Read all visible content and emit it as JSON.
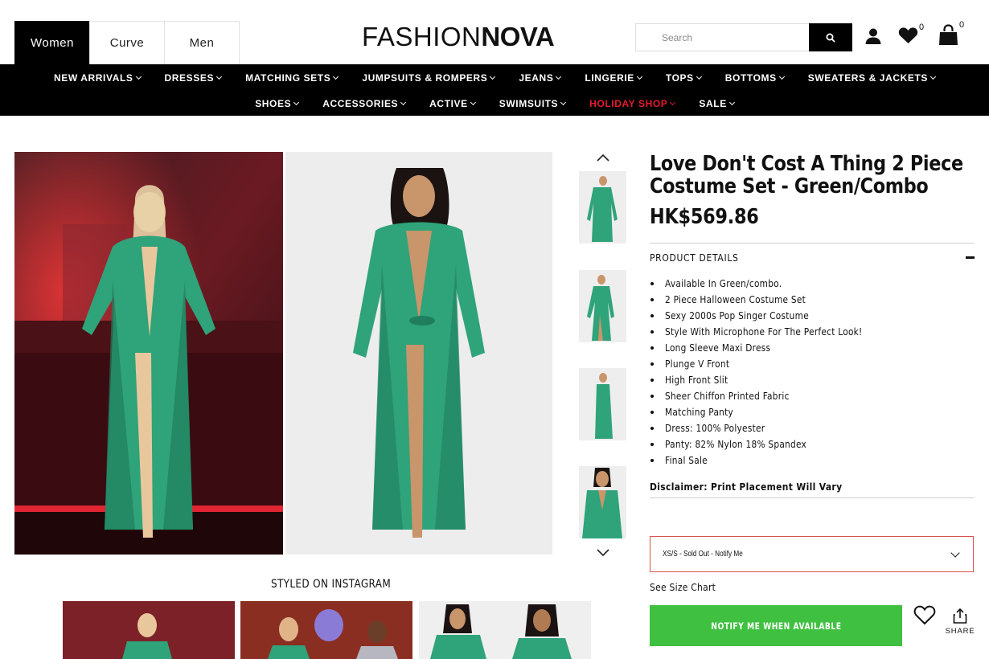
{
  "header": {
    "gender_tabs": [
      {
        "label": "Women",
        "active": true
      },
      {
        "label": "Curve",
        "active": false
      },
      {
        "label": "Men",
        "active": false
      }
    ],
    "logo_light": "FASHION",
    "logo_bold": "NOVA",
    "search_placeholder": "Search",
    "wishlist_count": "0",
    "cart_count": "0"
  },
  "nav": {
    "row1": [
      "NEW ARRIVALS",
      "DRESSES",
      "MATCHING SETS",
      "JUMPSUITS & ROMPERS",
      "JEANS",
      "LINGERIE",
      "TOPS",
      "BOTTOMS",
      "SWEATERS & JACKETS"
    ],
    "row2": [
      "SHOES",
      "ACCESSORIES",
      "ACTIVE",
      "SWIMSUITS",
      "HOLIDAY SHOP",
      "SALE"
    ],
    "highlight_color": "#e8192c"
  },
  "product": {
    "title": "Love Don't Cost A Thing 2 Piece Costume Set - Green/Combo",
    "price": "HK$569.86",
    "details_heading": "PRODUCT DETAILS",
    "details": [
      "Available In Green/combo.",
      "2 Piece Halloween Costume Set",
      "Sexy 2000s Pop Singer Costume",
      "Style With Microphone For The Perfect Look!",
      "Long Sleeve Maxi Dress",
      "Plunge V Front",
      "High Front Slit",
      "Sheer Chiffon Printed Fabric",
      "Matching Panty",
      "Dress: 100% Polyester",
      "Panty: 82% Nylon 18% Spandex",
      "Final Sale"
    ],
    "disclaimer": "Disclaimer: Print Placement Will Vary",
    "size_selected": "XS/S - Sold Out - Notify Me",
    "size_chart_label": "See Size Chart",
    "notify_label": "NOTIFY ME WHEN AVAILABLE",
    "share_label": "SHARE",
    "accent_green": "#40c040",
    "dress_green": "#2fa37a"
  },
  "instagram": {
    "heading": "STYLED ON INSTAGRAM"
  }
}
